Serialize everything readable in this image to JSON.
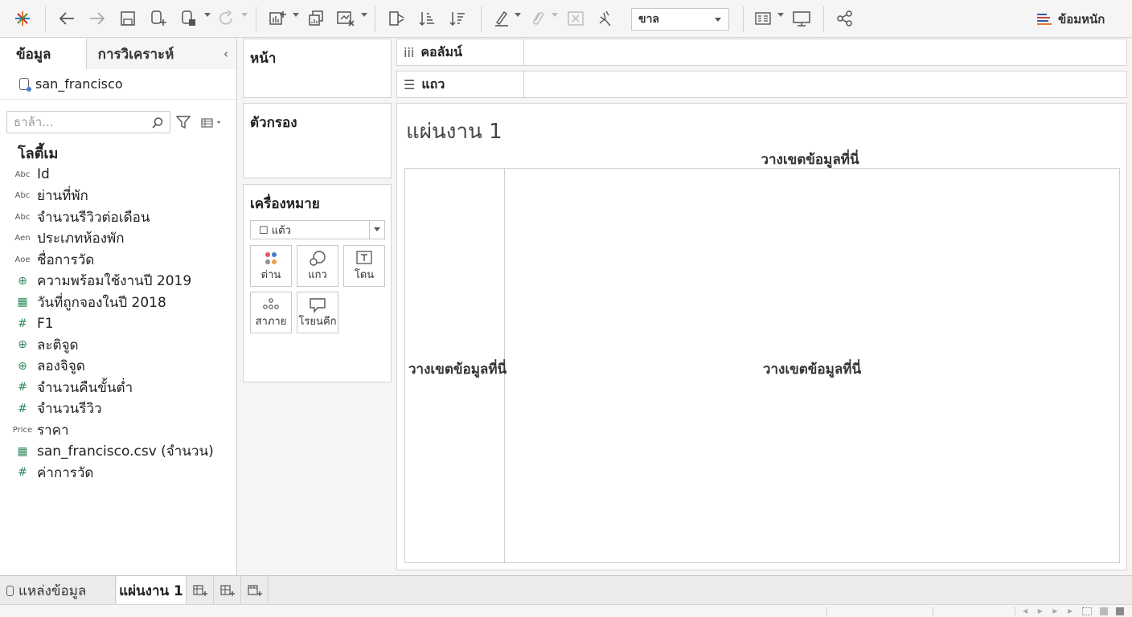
{
  "toolbar": {
    "fit_label": "ขาล",
    "show_me_label": "ข้อมหนัก"
  },
  "data_pane": {
    "tabs": [
      "ข้อมูล",
      "การวิเคราะห์"
    ],
    "datasource": "san_francisco",
    "search_placeholder": "ธาล้า...",
    "tables_header": "โลตี้เม",
    "fields": [
      {
        "icon": "Abc",
        "name": "Id"
      },
      {
        "icon": "Abc",
        "name": "ย่านที่พัก"
      },
      {
        "icon": "Abc",
        "name": "จำนวนรีวิวต่อเดือน"
      },
      {
        "icon": "Aen",
        "name": "ประเภทห้องพัก"
      },
      {
        "icon": "Aoe",
        "name": "ชื่อการวัด"
      },
      {
        "icon": "globe",
        "name": "ความพร้อมใช้งานปี 2019"
      },
      {
        "icon": "calendar",
        "name": "วันที่ถูกจองในปี 2018"
      },
      {
        "icon": "#",
        "name": "F1"
      },
      {
        "icon": "globe",
        "name": "ละติจูด"
      },
      {
        "icon": "globe",
        "name": "ลองจิจูด"
      },
      {
        "icon": "#",
        "name": "จำนวนคืนขั้นต่ำ"
      },
      {
        "icon": "#",
        "name": "จำนวนรีวิว"
      },
      {
        "icon": "Price",
        "name": "ราคา"
      },
      {
        "icon": "table",
        "name": "san_francisco.csv (จำนวน)"
      },
      {
        "icon": "#",
        "name": "ค่าการวัด"
      }
    ]
  },
  "cards": {
    "pages": "หน้า",
    "filters": "ตัวกรอง",
    "marks": "เครื่องหมาย",
    "mark_type": "☐ แต้ว",
    "mark_buttons": [
      "ต่าน",
      "แกว",
      "โดน",
      "สาภาย",
      "โรยนคีก"
    ]
  },
  "shelves": {
    "columns": "คอลัมน์",
    "rows": "แถว"
  },
  "canvas": {
    "sheet_title": "แผ่นงาน 1",
    "drop_top": "วางเขตข้อมูลที่นี่",
    "drop_left": "วางเขตข้อมูลที่นี่",
    "drop_center": "วางเขตข้อมูลที่นี่"
  },
  "bottom_tabs": {
    "datasource": "แหล่งข้อมูล",
    "sheet": "แผ่นงาน 1"
  }
}
